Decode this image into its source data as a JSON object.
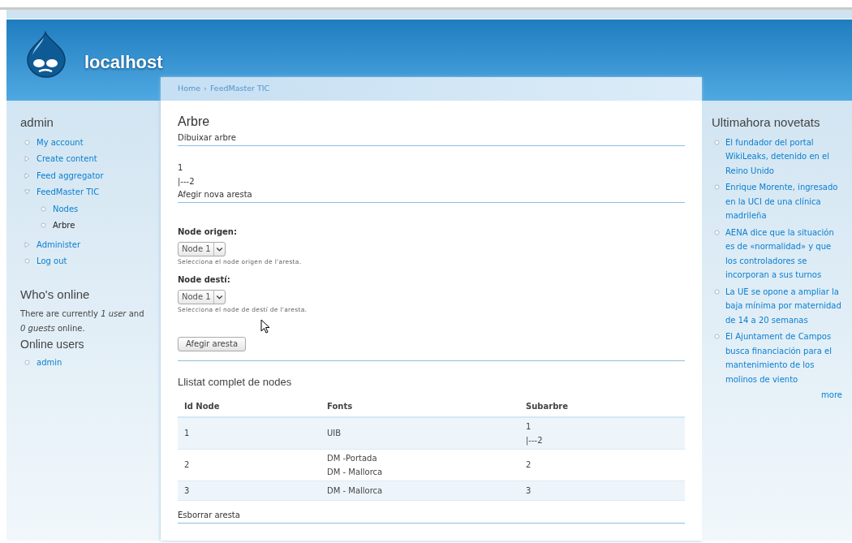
{
  "site": {
    "name": "localhost"
  },
  "breadcrumb": {
    "links": [
      "Home",
      "FeedMaster TIC"
    ],
    "separator": "›"
  },
  "left_sidebar": {
    "user_block": {
      "title": "admin",
      "items": [
        {
          "label": "My account",
          "kind": "leaf",
          "active": false
        },
        {
          "label": "Create content",
          "kind": "collapsed",
          "active": false
        },
        {
          "label": "Feed aggregator",
          "kind": "collapsed",
          "active": false
        },
        {
          "label": "FeedMaster TIC",
          "kind": "expanded",
          "active": false,
          "children": [
            {
              "label": "Nodes",
              "kind": "leaf",
              "active": false
            },
            {
              "label": "Arbre",
              "kind": "leaf",
              "active": true
            }
          ]
        },
        {
          "label": "Administer",
          "kind": "collapsed",
          "active": false
        },
        {
          "label": "Log out",
          "kind": "leaf",
          "active": false
        }
      ]
    },
    "whos_online": {
      "title": "Who's online",
      "text": "There are currently *1 user* and *0 guests* online.",
      "subtitle": "Online users",
      "users": [
        "admin"
      ]
    }
  },
  "main": {
    "title": "Arbre",
    "draw_heading": "Dibuixar arbre",
    "tree_lines": [
      "1",
      "|---2"
    ],
    "add_heading": "Afegir nova aresta",
    "fields": [
      {
        "label": "Node origen:",
        "value": "Node 1",
        "description": "Selecciona el node origen de l'aresta."
      },
      {
        "label": "Node destí:",
        "value": "Node 1",
        "description": "Selecciona el node de destí de l'aresta."
      }
    ],
    "submit": "Afegir aresta",
    "list_heading": "Llistat complet de nodes",
    "table": {
      "columns": [
        "Id Node",
        "Fonts",
        "Subarbre"
      ],
      "rows": [
        {
          "id": "1",
          "fonts": [
            "UIB"
          ],
          "subtree": [
            "1",
            "|---2"
          ]
        },
        {
          "id": "2",
          "fonts": [
            "DM -Portada",
            "DM - Mallorca"
          ],
          "subtree": [
            "2"
          ]
        },
        {
          "id": "3",
          "fonts": [
            "DM - Mallorca"
          ],
          "subtree": [
            "3"
          ]
        }
      ]
    },
    "delete_heading": "Esborrar aresta"
  },
  "right_sidebar": {
    "title": "Ultimahora novetats",
    "items": [
      "El fundador del portal WikiLeaks, detenido en el Reino Unido",
      "Enrique Morente, ingresado en la UCI de una clínica madrileña",
      "AENA dice que la situación es de «normalidad» y que los controladores se incorporan a sus turnos",
      "La UE se opone a ampliar la baja mínima por maternidad de 14 a 20 semanas",
      "El Ajuntament de Campos busca financiación para el mantenimiento de los molinos de viento"
    ],
    "more": "more"
  }
}
